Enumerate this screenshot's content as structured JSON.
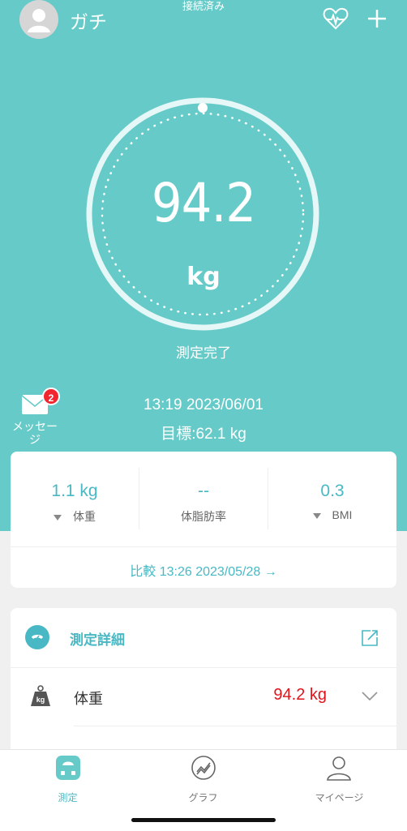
{
  "header": {
    "connection_status": "接続済み",
    "username": "ガチ"
  },
  "gauge": {
    "value": "94.2",
    "unit": "kg",
    "status": "測定完了"
  },
  "messages": {
    "label": "メッセージ",
    "count": "2"
  },
  "measurement": {
    "datetime": "13:19 2023/06/01",
    "goal": "目標:62.1 kg"
  },
  "summary": {
    "stats": [
      {
        "value": "1.1 kg",
        "label": "体重"
      },
      {
        "value": "--",
        "label": "体脂肪率"
      },
      {
        "value": "0.3",
        "label": "BMI"
      }
    ],
    "compare": "比較 13:26 2023/05/28 →"
  },
  "details": {
    "title": "測定詳細",
    "rows": [
      {
        "label": "体重",
        "value": "94.2 kg"
      }
    ]
  },
  "tabs": [
    {
      "label": "測定",
      "icon": "scale-icon",
      "active": true
    },
    {
      "label": "グラフ",
      "icon": "chart-icon",
      "active": false
    },
    {
      "label": "マイページ",
      "icon": "person-icon",
      "active": false
    }
  ],
  "colors": {
    "teal": "#66cbc8",
    "accent": "#48b9c4",
    "red": "#e0151b",
    "badge": "#f2262e"
  }
}
